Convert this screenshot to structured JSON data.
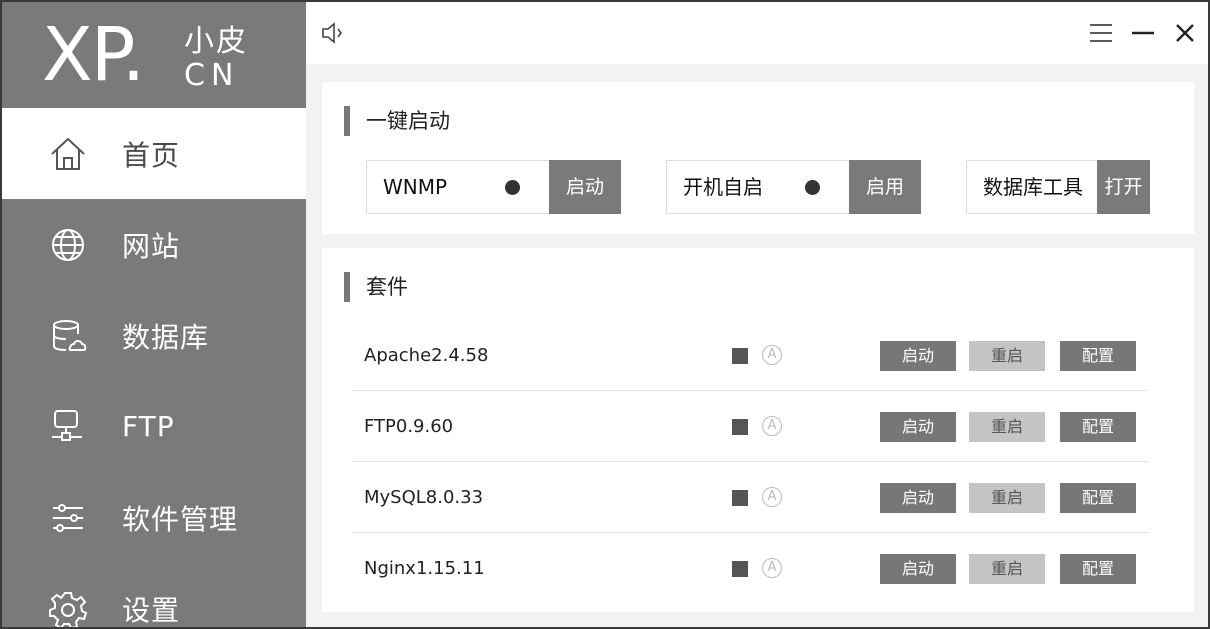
{
  "logo": {
    "main": "XP.",
    "sub_top": "小皮",
    "sub_bottom": "CN"
  },
  "sidebar": {
    "items": [
      {
        "label": "首页",
        "icon": "home-icon",
        "active": true
      },
      {
        "label": "网站",
        "icon": "globe-icon",
        "active": false
      },
      {
        "label": "数据库",
        "icon": "database-icon",
        "active": false
      },
      {
        "label": "FTP",
        "icon": "ftp-server-icon",
        "active": false
      },
      {
        "label": "软件管理",
        "icon": "sliders-icon",
        "active": false
      },
      {
        "label": "设置",
        "icon": "gear-icon",
        "active": false
      }
    ]
  },
  "titlebar": {
    "speaker_icon": "speaker-icon",
    "menu_icon": "menu-icon",
    "minimize_icon": "minimize-icon",
    "close_icon": "close-icon"
  },
  "quick_start": {
    "title": "一键启动",
    "items": [
      {
        "label": "WNMP",
        "button": "启动",
        "status_dot": true
      },
      {
        "label": "开机自启",
        "button": "启用",
        "status_dot": true
      },
      {
        "label": "数据库工具",
        "button": "打开",
        "status_dot": false
      }
    ]
  },
  "suite": {
    "title": "套件",
    "auto_symbol": "A",
    "rows": [
      {
        "name": "Apache2.4.58",
        "start": "启动",
        "restart": "重启",
        "config": "配置"
      },
      {
        "name": "FTP0.9.60",
        "start": "启动",
        "restart": "重启",
        "config": "配置"
      },
      {
        "name": "MySQL8.0.33",
        "start": "启动",
        "restart": "重启",
        "config": "配置"
      },
      {
        "name": "Nginx1.15.11",
        "start": "启动",
        "restart": "重启",
        "config": "配置"
      }
    ]
  },
  "colors": {
    "sidebar_bg": "#7a7a7a",
    "button_dark": "#777777",
    "button_light": "#c4c4c4",
    "panel_bg": "#f2f2f2"
  }
}
